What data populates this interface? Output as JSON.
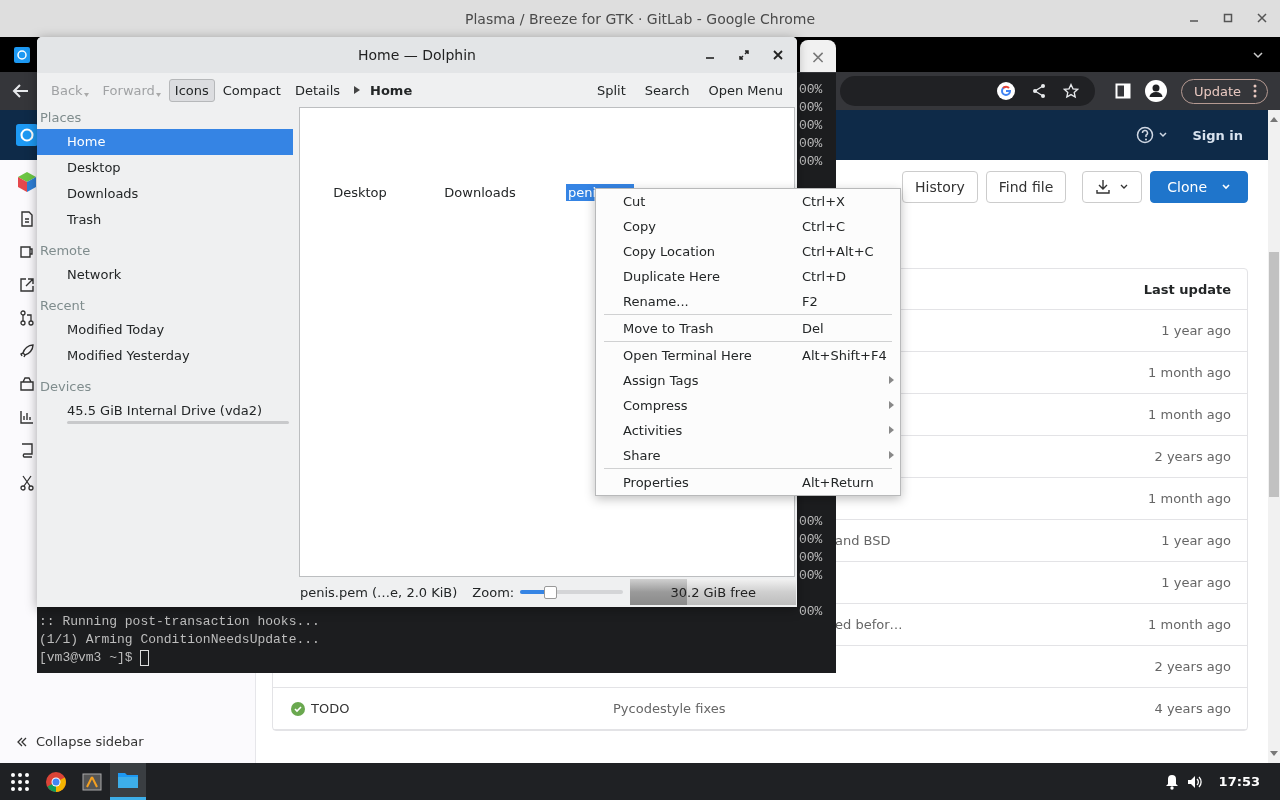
{
  "chrome": {
    "title": "Plasma / Breeze for GTK · GitLab - Google Chrome",
    "tab_close": "×",
    "update_button": "Update"
  },
  "gitlab": {
    "sign_in": "Sign in",
    "buttons": [
      "History",
      "Find file"
    ],
    "clone_button": "Clone",
    "collapse_sidebar": "Collapse sidebar",
    "table": {
      "last_update_header": "Last update",
      "rows": [
        {
          "last_update": "1 year ago"
        },
        {
          "last_update": "1 month ago"
        },
        {
          "last_update": "1 month ago"
        },
        {
          "last_update": "2 years ago"
        },
        {
          "last_update": "1 month ago"
        },
        {
          "message": "and BSD",
          "last_update": "1 year ago"
        },
        {
          "last_update": "1 year ago"
        },
        {
          "message": "ed befor…",
          "last_update": "1 month ago"
        },
        {
          "last_update": "2 years ago"
        },
        {
          "name": "TODO",
          "passed": true,
          "message": "Pycodestyle fixes",
          "last_update": "4 years ago"
        }
      ]
    }
  },
  "terminal": {
    "percent_groups": [
      [
        "00%",
        "00%",
        "00%",
        "00%",
        "00%"
      ],
      [
        "00%",
        "00%",
        "00%",
        "00%"
      ],
      [
        "00%"
      ]
    ],
    "lines": [
      ":: Running post-transaction hooks...",
      "(1/1) Arming ConditionNeedsUpdate...",
      "[vm3@vm3 ~]$ "
    ]
  },
  "dolphin": {
    "title": "Home — Dolphin",
    "toolbar": {
      "back": {
        "label": "Back",
        "disabled": true
      },
      "forward": {
        "label": "Forward",
        "disabled": true
      },
      "view_modes": [
        {
          "label": "Icons",
          "selected": true
        },
        {
          "label": "Compact",
          "selected": false
        },
        {
          "label": "Details",
          "selected": false
        }
      ],
      "breadcrumb": "Home",
      "actions": [
        "Split",
        "Search",
        "Open Menu"
      ]
    },
    "places": [
      {
        "heading": "Places",
        "items": [
          {
            "label": "Home",
            "selected": true
          },
          {
            "label": "Desktop",
            "selected": false
          },
          {
            "label": "Downloads",
            "selected": false
          },
          {
            "label": "Trash",
            "selected": false
          }
        ]
      },
      {
        "heading": "Remote",
        "items": [
          {
            "label": "Network",
            "selected": false
          }
        ]
      },
      {
        "heading": "Recent",
        "items": [
          {
            "label": "Modified Today",
            "selected": false
          },
          {
            "label": "Modified Yesterday",
            "selected": false
          }
        ]
      },
      {
        "heading": "Devices",
        "items": [
          {
            "label": "45.5 GiB Internal Drive (vda2)",
            "selected": false,
            "kind": "drive"
          }
        ]
      }
    ],
    "files": [
      {
        "name": "Desktop",
        "selected": false
      },
      {
        "name": "Downloads",
        "selected": false
      },
      {
        "name": "peni",
        "selected": true
      }
    ],
    "status": {
      "text": "penis.pem (…e, 2.0 KiB)",
      "zoom_label": "Zoom:",
      "zoom": {
        "level": 0.29
      },
      "free_space": {
        "text": "30.2 GiB free",
        "level": 0.34
      }
    }
  },
  "context_menu": [
    {
      "kind": "action",
      "label": "Cut",
      "shortcut": "Ctrl+X"
    },
    {
      "kind": "action",
      "label": "Copy",
      "shortcut": "Ctrl+C"
    },
    {
      "kind": "action",
      "label": "Copy Location",
      "shortcut": "Ctrl+Alt+C"
    },
    {
      "kind": "action",
      "label": "Duplicate Here",
      "shortcut": "Ctrl+D"
    },
    {
      "kind": "action",
      "label": "Rename...",
      "shortcut": "F2"
    },
    {
      "kind": "separator"
    },
    {
      "kind": "action",
      "label": "Move to Trash",
      "shortcut": "Del"
    },
    {
      "kind": "separator"
    },
    {
      "kind": "action",
      "label": "Open Terminal Here",
      "shortcut": "Alt+Shift+F4"
    },
    {
      "kind": "submenu",
      "label": "Assign Tags"
    },
    {
      "kind": "submenu",
      "label": "Compress"
    },
    {
      "kind": "submenu",
      "label": "Activities"
    },
    {
      "kind": "submenu",
      "label": "Share"
    },
    {
      "kind": "separator"
    },
    {
      "kind": "action",
      "label": "Properties",
      "shortcut": "Alt+Return"
    }
  ],
  "taskbar": {
    "tasks": [
      {
        "kind": "launcher",
        "active": false
      },
      {
        "kind": "browser",
        "active": false
      },
      {
        "kind": "editor",
        "active": false
      },
      {
        "kind": "file-manager",
        "active": true
      }
    ],
    "clock": "17:53"
  }
}
